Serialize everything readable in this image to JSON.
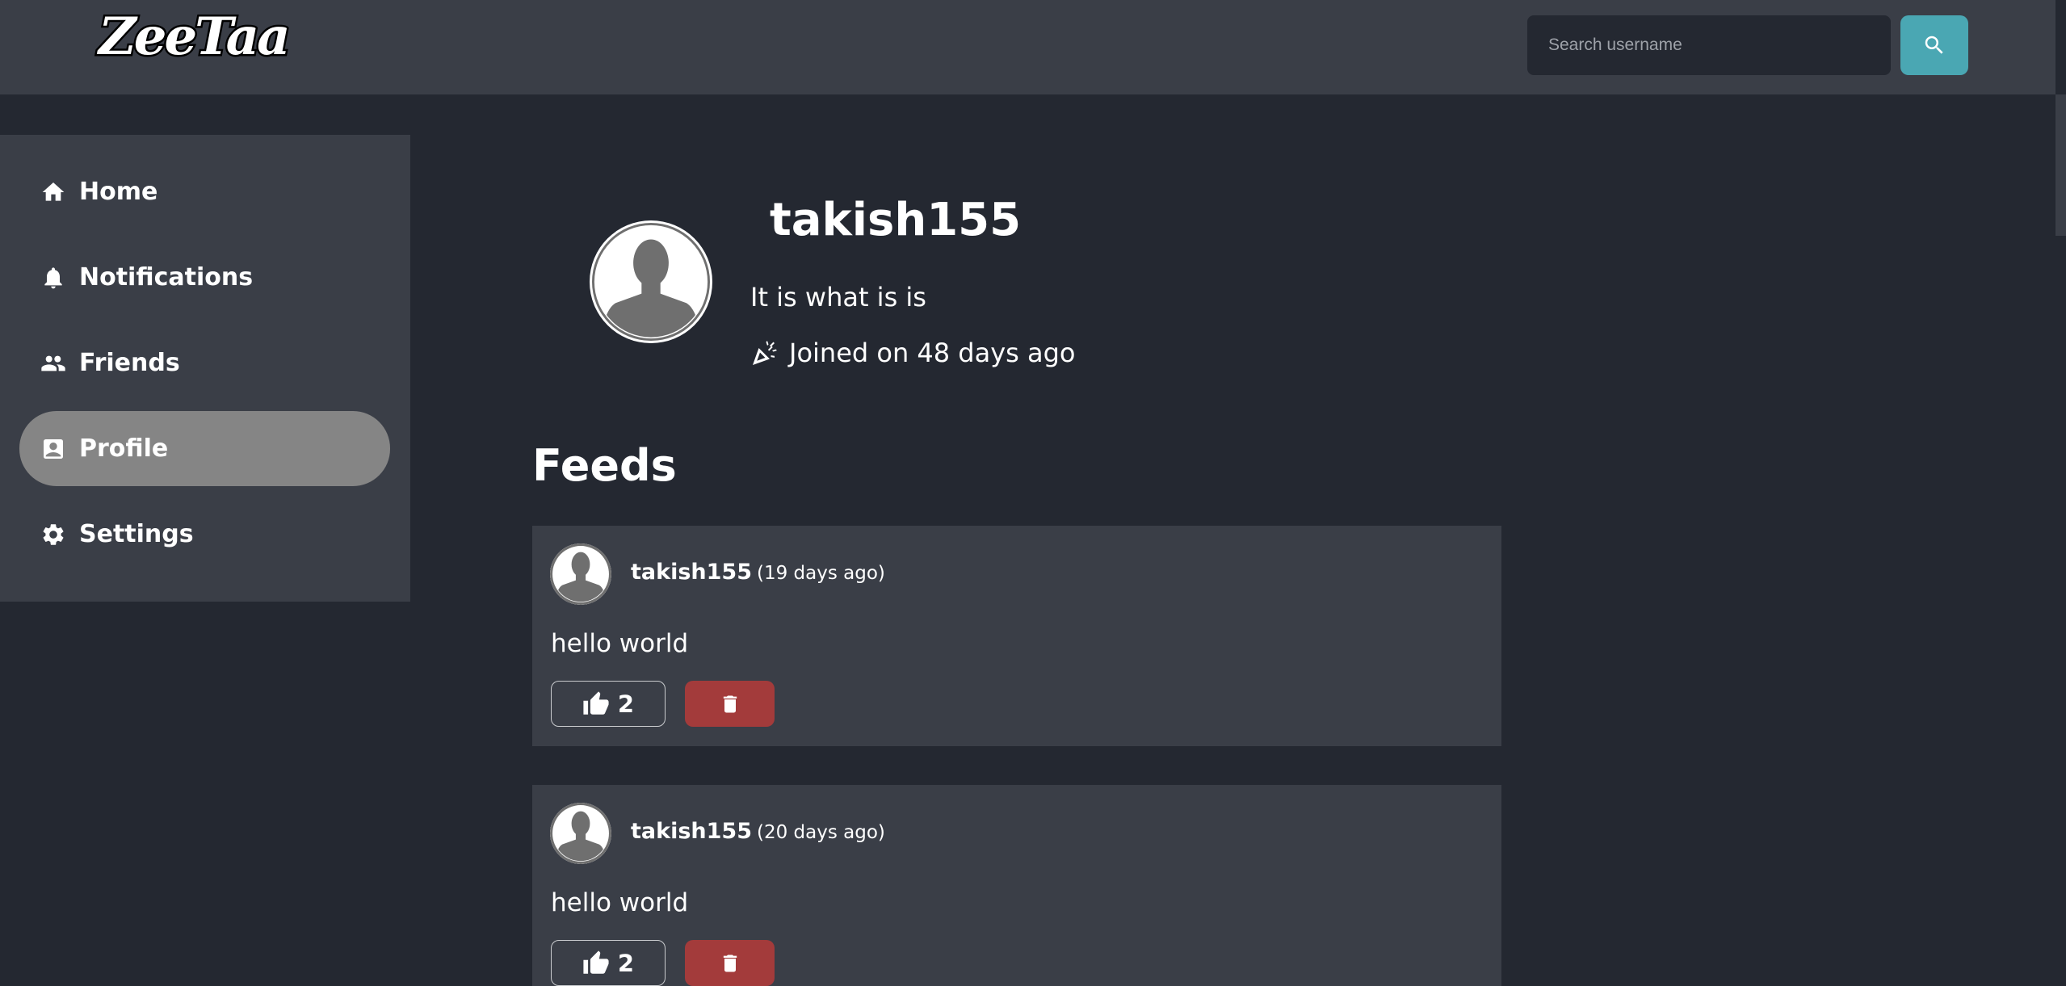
{
  "header": {
    "logo_text": "ZeeTaa",
    "search_placeholder": "Search username",
    "search_value": ""
  },
  "sidebar": {
    "items": [
      {
        "label": "Home",
        "icon": "home-icon",
        "active": false
      },
      {
        "label": "Notifications",
        "icon": "bell-icon",
        "active": false
      },
      {
        "label": "Friends",
        "icon": "people-icon",
        "active": false
      },
      {
        "label": "Profile",
        "icon": "profile-card-icon",
        "active": true
      },
      {
        "label": "Settings",
        "icon": "gear-icon",
        "active": false
      }
    ]
  },
  "profile": {
    "username": "takish155",
    "bio": "It is what is is",
    "joined": "Joined on 48 days ago"
  },
  "feeds": {
    "title": "Feeds",
    "posts": [
      {
        "author": "takish155",
        "time": "(19 days ago)",
        "text": "hello world",
        "likes": "2"
      },
      {
        "author": "takish155",
        "time": "(20 days ago)",
        "text": "hello world",
        "likes": "2"
      }
    ]
  },
  "colors": {
    "background": "#242831",
    "panel": "#3a3e47",
    "active_nav": "#858585",
    "search_button": "#4aa7b3",
    "delete_button": "#a33b3b"
  }
}
